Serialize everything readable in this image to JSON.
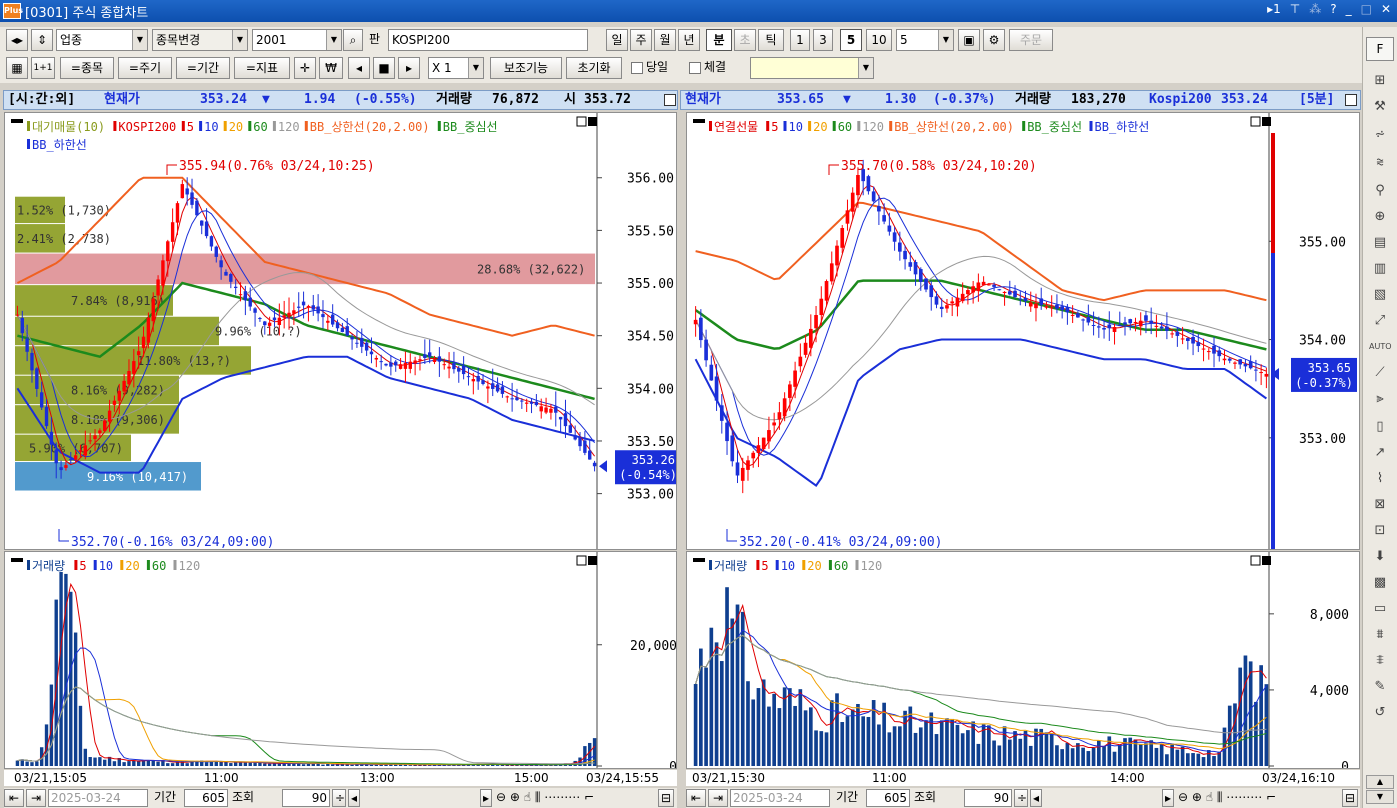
{
  "window": {
    "logo": "Plus",
    "title": "[0301] 주식 종합차트"
  },
  "titlebar_icons": [
    "1",
    "?",
    "_",
    "□",
    "X"
  ],
  "toolbar1": {
    "nav_left_right": "◂▸",
    "nav_up_down": "⇕",
    "market_select": "업종",
    "change_button": "종목변경",
    "code_input": "2001",
    "pan_label": "판",
    "name_field": "KOSPI200",
    "period_buttons": [
      "일",
      "주",
      "월",
      "년",
      "분",
      "초",
      "틱"
    ],
    "period_selected": "분",
    "period_disabled": "초",
    "interval_buttons": [
      "1",
      "3",
      "5",
      "10"
    ],
    "interval_selected": "5",
    "interval_input": "5",
    "order_button": "주문"
  },
  "toolbar2": {
    "grid_icon": "grid",
    "one_to_one": "1+1",
    "same_stock": "=종목",
    "same_period": "=주기",
    "same_range": "=기간",
    "same_indicator": "=지표",
    "multiplier": "X 1",
    "aux_button": "보조기능",
    "reset_button": "초기화",
    "same_day_label": "당일",
    "fill_label": "체결",
    "color_select": ""
  },
  "info_left": {
    "tag": "[시:간:외]",
    "price_label": "현재가",
    "price": "353.24",
    "arrow": "▼",
    "change": "1.94",
    "change_pct": "(-0.55%)",
    "volume_label": "거래량",
    "volume": "76,872",
    "open_label": "시",
    "open": "353.72"
  },
  "info_right": {
    "price_label": "현재가",
    "price": "353.65",
    "arrow": "▼",
    "change": "1.30",
    "change_pct": "(-0.37%)",
    "volume_label": "거래량",
    "volume": "183,270",
    "index_name": "Kospi200",
    "index_value": "353.24",
    "interval_tag": "[5분]"
  },
  "left_price": {
    "legend1": [
      "대기매물(10)",
      "KOSPI200",
      "5",
      "10",
      "20",
      "60",
      "120",
      "BB_상한선(20,2.00)",
      "BB_중심선"
    ],
    "legend2": [
      "BB_하한선"
    ],
    "legend_colors": [
      "#8a9b1e",
      "#e00000",
      "#e00000",
      "#1a2fd8",
      "#f0a000",
      "#1c8a1c",
      "#999999",
      "#f06020",
      "#1c8a1c",
      "#1a2fd8"
    ],
    "high_note": "355.94(0.76% 03/24,10:25)",
    "low_note": "352.70(-0.16% 03/24,09:00)",
    "y_ticks": [
      "356.00",
      "355.50",
      "355.00",
      "354.50",
      "354.00",
      "353.50",
      "353.00"
    ],
    "y_range": [
      352.55,
      356.33
    ],
    "current_price_tag": "353.26",
    "current_pct_tag": "(-0.54%)",
    "profile_labels": [
      "1.52% (1,730)",
      "2.41% (2,738)",
      "28.68% (32,622)",
      "7.84% (8,916)",
      "9.96% (10,?)",
      "11.80% (13,?)",
      "8.16% (9,282)",
      "8.18% (9,306)",
      "5.90% (6,707)",
      "9.16% (10,417)"
    ]
  },
  "left_volume": {
    "legend": [
      "거래량",
      "5",
      "10",
      "20",
      "60",
      "120"
    ],
    "y_ticks": [
      "20,000",
      "0"
    ],
    "y_max": 32000
  },
  "left_xaxis": [
    "03/21,15:05",
    "11:00",
    "13:00",
    "15:00",
    "03/24,15:55"
  ],
  "right_price": {
    "legend": [
      "연결선물",
      "5",
      "10",
      "20",
      "60",
      "120",
      "BB_상한선(20,2.00)",
      "BB_중심선",
      "BB_하한선"
    ],
    "legend_colors": [
      "#e00000",
      "#e00000",
      "#1a2fd8",
      "#f0a000",
      "#1c8a1c",
      "#999999",
      "#f06020",
      "#1c8a1c",
      "#1a2fd8"
    ],
    "high_note": "355.70(0.58% 03/24,10:20)",
    "low_note": "352.20(-0.41% 03/24,09:00)",
    "y_ticks": [
      "355.00",
      "354.00",
      "353.00"
    ],
    "y_range": [
      351.95,
      356.0
    ],
    "current_price_tag": "353.65",
    "current_pct_tag": "(-0.37%)"
  },
  "right_volume": {
    "legend": [
      "거래량",
      "5",
      "10",
      "20",
      "60",
      "120"
    ],
    "y_ticks": [
      "8,000",
      "4,000",
      "0"
    ],
    "y_max": 10200
  },
  "right_xaxis": [
    "03/21,15:30",
    "11:00",
    "14:00",
    "03/24,16:10"
  ],
  "bottom_left": {
    "date": "2025-03-24",
    "period_label": "기간",
    "period_value": "605",
    "query_label": "조회",
    "query_value": "90"
  },
  "bottom_right": {
    "date": "2025-03-24",
    "period_label": "기간",
    "period_value": "605",
    "query_label": "조회",
    "query_value": "90"
  },
  "chart_data": [
    {
      "type": "line",
      "title": "KOSPI200",
      "y_unit": "index",
      "ylim": [
        352.55,
        356.33
      ],
      "x": [
        "03/21,15:05",
        "11:00",
        "13:00",
        "15:00",
        "03/24,15:55"
      ],
      "series": [
        {
          "name": "KOSPI200",
          "values": [
            354.7,
            353.2,
            353.6,
            354.4,
            355.94,
            355.1,
            354.6,
            354.8,
            354.5,
            354.2,
            354.3,
            354.1,
            353.9,
            353.8,
            353.26
          ]
        },
        {
          "name": "BB_상한선(20,2.00)",
          "values": [
            355.0,
            355.2,
            355.6,
            356.0,
            356.0,
            355.6,
            355.2,
            355.1,
            355.0,
            354.9,
            354.7,
            354.6,
            354.5,
            354.6,
            354.5
          ]
        },
        {
          "name": "BB_중심선",
          "values": [
            354.5,
            354.4,
            354.3,
            354.6,
            355.0,
            354.9,
            354.8,
            354.6,
            354.5,
            354.4,
            354.3,
            354.2,
            354.1,
            354.0,
            353.9
          ]
        },
        {
          "name": "BB_하한선",
          "values": [
            354.0,
            353.4,
            353.2,
            353.2,
            353.9,
            354.1,
            354.2,
            354.3,
            354.3,
            354.1,
            354.0,
            353.9,
            353.7,
            353.6,
            353.5
          ]
        }
      ]
    },
    {
      "type": "bar",
      "title": "거래량",
      "series": [
        {
          "name": "거래량",
          "values": [
            800,
            1000,
            32000,
            1600,
            1200,
            900,
            800,
            700,
            700,
            600,
            500,
            500,
            400,
            400,
            300,
            300,
            300,
            200,
            200,
            200,
            300,
            200,
            200,
            200,
            400,
            3800
          ]
        }
      ]
    },
    {
      "type": "line",
      "title": "연결선물",
      "ylim": [
        351.95,
        356.0
      ],
      "series": [
        {
          "name": "연결선물",
          "values": [
            354.2,
            352.6,
            353.2,
            354.3,
            355.7,
            354.9,
            354.3,
            354.6,
            354.4,
            354.3,
            354.1,
            354.2,
            354.0,
            353.8,
            353.65
          ]
        },
        {
          "name": "BB_상한선(20,2.00)",
          "values": [
            354.9,
            354.8,
            354.6,
            355.0,
            355.4,
            355.3,
            355.2,
            355.1,
            354.8,
            354.5,
            354.4,
            354.5,
            354.5,
            354.5,
            354.4
          ]
        },
        {
          "name": "BB_중심선",
          "values": [
            354.3,
            354.0,
            353.9,
            354.1,
            354.6,
            354.6,
            354.6,
            354.5,
            354.4,
            354.3,
            354.2,
            354.1,
            354.1,
            354.0,
            353.9
          ]
        },
        {
          "name": "BB_하한선",
          "values": [
            353.8,
            353.0,
            352.8,
            352.5,
            353.6,
            353.9,
            354.0,
            354.0,
            354.0,
            353.9,
            353.8,
            353.8,
            353.7,
            353.7,
            353.4
          ]
        }
      ]
    },
    {
      "type": "bar",
      "title": "거래량",
      "series": [
        {
          "name": "거래량",
          "values": [
            4500,
            9400,
            6000,
            3800,
            3500,
            3000,
            2800,
            2600,
            2500,
            2300,
            2200,
            2000,
            1800,
            1700,
            1600,
            1500,
            1400,
            1300,
            1200,
            1100,
            1000,
            900,
            800,
            700,
            5500,
            5300
          ]
        }
      ]
    }
  ]
}
